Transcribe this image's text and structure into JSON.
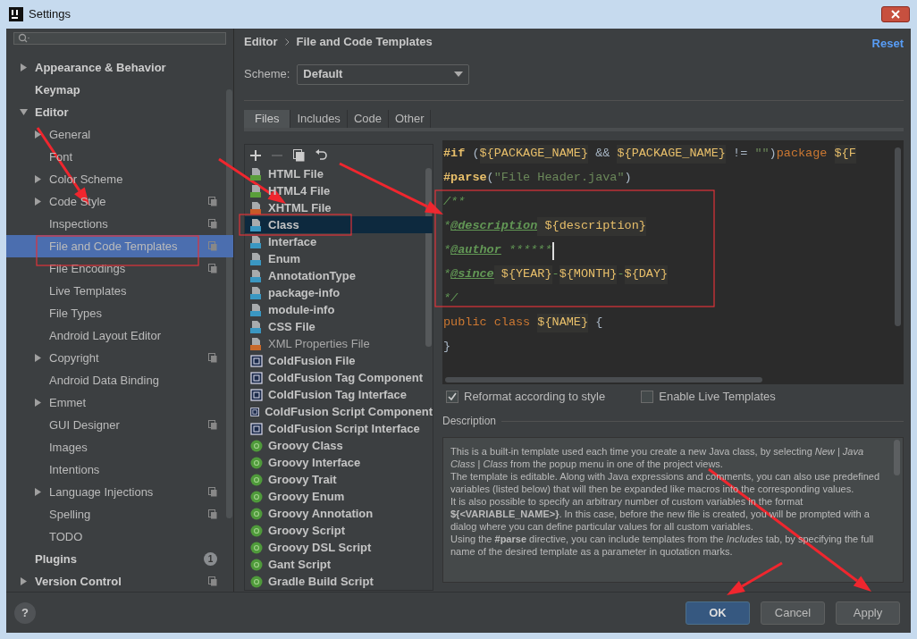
{
  "window": {
    "title": "Settings"
  },
  "sidebar": {
    "items": [
      {
        "label": "Appearance & Behavior",
        "bold": true,
        "expanded": false,
        "selected": false,
        "project": false
      },
      {
        "label": "Keymap",
        "bold": true,
        "selected": false,
        "project": false
      },
      {
        "label": "Editor",
        "bold": true,
        "expanded": true,
        "selected": false,
        "project": false,
        "children": [
          {
            "label": "General",
            "bold": false,
            "expanded": false,
            "selected": false,
            "project": false
          },
          {
            "label": "Font",
            "bold": false,
            "selected": false,
            "project": false
          },
          {
            "label": "Color Scheme",
            "bold": false,
            "expanded": false,
            "selected": false,
            "project": false
          },
          {
            "label": "Code Style",
            "bold": false,
            "expanded": false,
            "selected": false,
            "project": true
          },
          {
            "label": "Inspections",
            "bold": false,
            "selected": false,
            "project": true
          },
          {
            "label": "File and Code Templates",
            "bold": false,
            "selected": true,
            "project": true
          },
          {
            "label": "File Encodings",
            "bold": false,
            "selected": false,
            "project": true
          },
          {
            "label": "Live Templates",
            "bold": false,
            "selected": false,
            "project": false
          },
          {
            "label": "File Types",
            "bold": false,
            "selected": false,
            "project": false
          },
          {
            "label": "Android Layout Editor",
            "bold": false,
            "selected": false,
            "project": false
          },
          {
            "label": "Copyright",
            "bold": false,
            "expanded": false,
            "selected": false,
            "project": true
          },
          {
            "label": "Android Data Binding",
            "bold": false,
            "selected": false,
            "project": false
          },
          {
            "label": "Emmet",
            "bold": false,
            "expanded": false,
            "selected": false,
            "project": false
          },
          {
            "label": "GUI Designer",
            "bold": false,
            "selected": false,
            "project": true
          },
          {
            "label": "Images",
            "bold": false,
            "selected": false,
            "project": false
          },
          {
            "label": "Intentions",
            "bold": false,
            "selected": false,
            "project": false
          },
          {
            "label": "Language Injections",
            "bold": false,
            "expanded": false,
            "selected": false,
            "project": true
          },
          {
            "label": "Spelling",
            "bold": false,
            "selected": false,
            "project": true
          },
          {
            "label": "TODO",
            "bold": false,
            "selected": false,
            "project": false
          }
        ]
      },
      {
        "label": "Plugins",
        "bold": true,
        "selected": false,
        "project": false,
        "badge": "1"
      },
      {
        "label": "Version Control",
        "bold": true,
        "expanded": false,
        "selected": false,
        "project": true
      }
    ]
  },
  "breadcrumb": [
    "Editor",
    "File and Code Templates"
  ],
  "help": "?",
  "reset": "Reset",
  "scheme": {
    "label": "Scheme:",
    "value": "Default"
  },
  "tabs": [
    {
      "label": "Files",
      "selected": true
    },
    {
      "label": "Includes",
      "selected": false
    },
    {
      "label": "Code",
      "selected": false
    },
    {
      "label": "Other",
      "selected": false
    }
  ],
  "templates": [
    {
      "name": "HTML File",
      "kind": "html",
      "bold": true,
      "selected": false
    },
    {
      "name": "HTML4 File",
      "kind": "html4",
      "bold": true,
      "selected": false
    },
    {
      "name": "XHTML File",
      "kind": "xhtml",
      "bold": true,
      "selected": false
    },
    {
      "name": "Class",
      "kind": "java",
      "bold": true,
      "selected": true
    },
    {
      "name": "Interface",
      "kind": "java",
      "bold": true,
      "selected": false
    },
    {
      "name": "Enum",
      "kind": "java",
      "bold": true,
      "selected": false
    },
    {
      "name": "AnnotationType",
      "kind": "java",
      "bold": true,
      "selected": false
    },
    {
      "name": "package-info",
      "kind": "java",
      "bold": true,
      "selected": false
    },
    {
      "name": "module-info",
      "kind": "java",
      "bold": true,
      "selected": false
    },
    {
      "name": "CSS File",
      "kind": "css",
      "bold": true,
      "selected": false
    },
    {
      "name": "XML Properties File",
      "kind": "xml",
      "bold": false,
      "selected": false
    },
    {
      "name": "ColdFusion File",
      "kind": "cf",
      "bold": true,
      "selected": false
    },
    {
      "name": "ColdFusion Tag Component",
      "kind": "cf",
      "bold": true,
      "selected": false
    },
    {
      "name": "ColdFusion Tag Interface",
      "kind": "cf",
      "bold": true,
      "selected": false
    },
    {
      "name": "ColdFusion Script Component",
      "kind": "cf",
      "bold": true,
      "selected": false
    },
    {
      "name": "ColdFusion Script Interface",
      "kind": "cf",
      "bold": true,
      "selected": false
    },
    {
      "name": "Groovy Class",
      "kind": "groovy",
      "bold": true,
      "selected": false
    },
    {
      "name": "Groovy Interface",
      "kind": "groovy",
      "bold": true,
      "selected": false
    },
    {
      "name": "Groovy Trait",
      "kind": "groovy",
      "bold": true,
      "selected": false
    },
    {
      "name": "Groovy Enum",
      "kind": "groovy",
      "bold": true,
      "selected": false
    },
    {
      "name": "Groovy Annotation",
      "kind": "groovy",
      "bold": true,
      "selected": false
    },
    {
      "name": "Groovy Script",
      "kind": "groovy",
      "bold": true,
      "selected": false
    },
    {
      "name": "Groovy DSL Script",
      "kind": "groovy",
      "bold": true,
      "selected": false
    },
    {
      "name": "Gant Script",
      "kind": "groovy",
      "bold": true,
      "selected": false
    },
    {
      "name": "Gradle Build Script",
      "kind": "groovy",
      "bold": true,
      "selected": false
    }
  ],
  "editor": {
    "lines": [
      {
        "caret": false,
        "tokens": [
          {
            "kind": "directive",
            "text": "#if"
          },
          {
            "kind": "plain",
            "text": " ("
          },
          {
            "kind": "var",
            "text": "${PACKAGE_NAME}"
          },
          {
            "kind": "plain",
            "text": " && "
          },
          {
            "kind": "var",
            "text": "${PACKAGE_NAME}"
          },
          {
            "kind": "plain",
            "text": " != "
          },
          {
            "kind": "string",
            "text": "\"\""
          },
          {
            "kind": "plain",
            "text": ")"
          },
          {
            "kind": "keyword",
            "text": "package "
          },
          {
            "kind": "var",
            "text": "${F"
          }
        ]
      },
      {
        "caret": false,
        "tokens": [
          {
            "kind": "directive",
            "text": "#parse"
          },
          {
            "kind": "plain",
            "text": "("
          },
          {
            "kind": "string",
            "text": "\"File Header.java\""
          },
          {
            "kind": "plain",
            "text": ")"
          }
        ]
      },
      {
        "caret": false,
        "tokens": [
          {
            "kind": "doc",
            "text": "/**"
          }
        ]
      },
      {
        "caret": false,
        "tokens": [
          {
            "kind": "doc",
            "text": "*"
          },
          {
            "kind": "doctag",
            "text": "@description"
          },
          {
            "kind": "var",
            "text": " ${description}"
          }
        ]
      },
      {
        "caret": true,
        "tokens": [
          {
            "kind": "doc",
            "text": "*"
          },
          {
            "kind": "doctag",
            "text": "@author"
          },
          {
            "kind": "doc",
            "text": " ******"
          }
        ]
      },
      {
        "caret": false,
        "tokens": [
          {
            "kind": "doc",
            "text": "*"
          },
          {
            "kind": "doctag",
            "text": "@since"
          },
          {
            "kind": "var",
            "text": " ${YEAR}"
          },
          {
            "kind": "doc",
            "text": "-"
          },
          {
            "kind": "var",
            "text": "${MONTH}"
          },
          {
            "kind": "doc",
            "text": "-"
          },
          {
            "kind": "var",
            "text": "${DAY}"
          }
        ]
      },
      {
        "caret": false,
        "tokens": [
          {
            "kind": "doc",
            "text": "*/"
          }
        ]
      },
      {
        "caret": false,
        "tokens": [
          {
            "kind": "keyword",
            "text": "public class "
          },
          {
            "kind": "var",
            "text": "${NAME}"
          },
          {
            "kind": "plain",
            "text": " {"
          }
        ]
      },
      {
        "caret": false,
        "tokens": [
          {
            "kind": "plain",
            "text": "}"
          }
        ]
      }
    ]
  },
  "options": [
    {
      "label": "Reformat according to style",
      "checked": true
    },
    {
      "label": "Enable Live Templates",
      "checked": false
    }
  ],
  "description": {
    "title": "Description",
    "paragraphs": [
      "This is a built-in template used each time you create a new Java class, by selecting *New* | *Java Class* | *Class* from the popup menu in one of the project views.",
      "The template is editable. Along with Java expressions and comments, you can also use predefined variables (listed below) that will then be expanded like macros into the corresponding values.",
      "It is also possible to specify an arbitrary number of custom variables in the format **${<VARIABLE_NAME>}**. In this case, before the new file is created, you will be prompted with a dialog where you can define particular values for all custom variables.",
      "Using the **#parse** directive, you can include templates from the *Includes* tab, by specifying the full name of the desired template as a parameter in quotation marks."
    ]
  },
  "buttons": [
    {
      "label": "OK",
      "primary": true
    },
    {
      "label": "Cancel",
      "primary": false
    },
    {
      "label": "Apply",
      "primary": false
    }
  ]
}
